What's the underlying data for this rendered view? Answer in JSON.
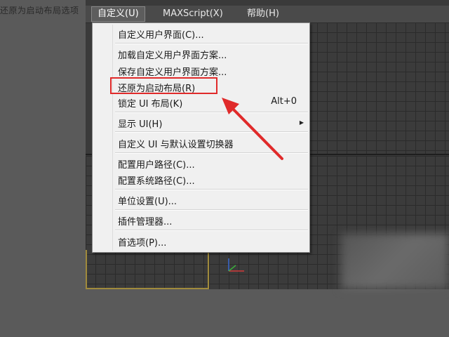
{
  "caption": "还原为启动布局选项",
  "menubar": {
    "items": [
      "自定义(U)",
      "MAXScript(X)",
      "帮助(H)"
    ]
  },
  "menu": {
    "items": [
      {
        "label": "自定义用户界面(C)..."
      },
      {
        "label": "加载自定义用户界面方案..."
      },
      {
        "label": "保存自定义用户界面方案..."
      },
      {
        "label": "还原为启动布局(R)"
      },
      {
        "label": "锁定 UI 布局(K)",
        "shortcut": "Alt+0"
      },
      {
        "label": "显示 UI(H)"
      },
      {
        "label": "自定义 UI 与默认设置切换器"
      },
      {
        "label": "配置用户路径(C)..."
      },
      {
        "label": "配置系统路径(C)..."
      },
      {
        "label": "单位设置(U)..."
      },
      {
        "label": "插件管理器..."
      },
      {
        "label": "首选项(P)..."
      }
    ]
  },
  "colors": {
    "highlight_box": "#e02a2a",
    "annotation_arrow": "#e02a2a",
    "menu_bg": "#f0f0f0",
    "menubar_bg": "#4a4a4a",
    "viewport_bg": "#3b3b3b"
  }
}
